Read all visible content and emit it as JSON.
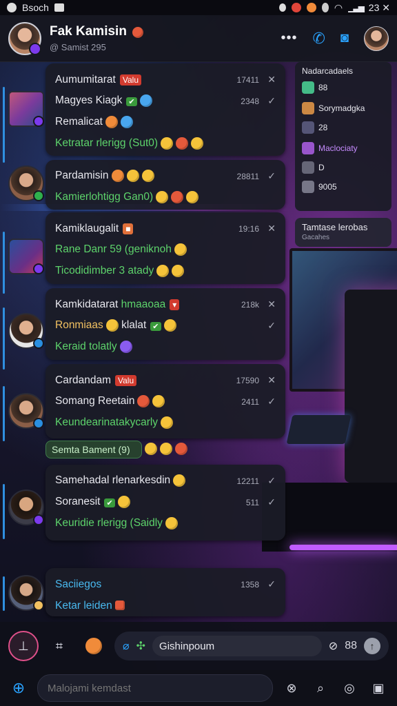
{
  "status": {
    "left_text": "Bsoch",
    "right_text": "23 ✕"
  },
  "header": {
    "title": "Fak Kamisin",
    "subtitle": "@ Samist 295"
  },
  "right_panel": {
    "title": "Nadarcadaels",
    "rows": [
      {
        "label": "88",
        "icon": "game-icon"
      },
      {
        "label": "Sorymadgka",
        "icon": "star-icon"
      },
      {
        "label": "28",
        "icon": "game-icon"
      },
      {
        "label": "Maclociaty",
        "icon": "crown-icon"
      },
      {
        "label": "D",
        "icon": "grid-icon"
      },
      {
        "label": "9005",
        "icon": "image-icon"
      }
    ],
    "popup_title": "Tamtase lerobas",
    "popup_sub": "Gacahes"
  },
  "messages": [
    {
      "lines": [
        {
          "text": "Aumumitarat",
          "tag": "Valu",
          "time": "17411",
          "tick": "✕"
        },
        {
          "text": "Magyes Kiagk",
          "time": "2348",
          "tick": "✓"
        },
        {
          "text": "Remalicat"
        },
        {
          "text": "Ketratar rlerigg (Sut0)",
          "style": "green"
        }
      ]
    },
    {
      "lines": [
        {
          "text": "Pardamisin",
          "time": "28811",
          "tick": "✓"
        },
        {
          "text": "Kamierlohtigg Gan0)",
          "style": "green"
        }
      ]
    },
    {
      "lines": [
        {
          "text": "Kamiklaugalit",
          "time": "19:16",
          "tick": "✕"
        },
        {
          "text": "Rane Danr 59 (geniknoh",
          "style": "green"
        },
        {
          "text": "Ticodidimber 3 atady",
          "style": "green"
        }
      ]
    },
    {
      "lines": [
        {
          "text": "Kamkidatarat",
          "text2": "hmaaoaa",
          "time": "218k",
          "tick": "✕"
        },
        {
          "text": "Ronmiaas",
          "text2": "klalat",
          "style": "gold",
          "tick": "✓"
        },
        {
          "text": "Keraid tolatly",
          "style": "green"
        }
      ]
    },
    {
      "lines": [
        {
          "text": "Cardandam",
          "tag": "Valu",
          "time": "17590",
          "tick": "✕"
        },
        {
          "text": "Somang Reetain",
          "time": "2411",
          "tick": "✓"
        },
        {
          "text": "Keundearinatakycarly",
          "style": "green"
        }
      ]
    },
    {
      "media_label": "Semta Bament (9)"
    },
    {
      "lines": [
        {
          "text": "Samehadal rlenarkesdin",
          "time": "12211",
          "tick": "✓"
        },
        {
          "text": "Soranesit",
          "time": "511",
          "tick": "✓"
        },
        {
          "text": "Keuridie rlerigg (Saidly",
          "style": "green"
        }
      ]
    },
    {
      "lines": [
        {
          "text": "Saciiegos",
          "style": "cyan",
          "time": "1358",
          "tick": "✓"
        },
        {
          "text": "Ketar leiden",
          "style": "cyan"
        }
      ]
    }
  ],
  "composer": {
    "value": "Gishinpoum",
    "count": "88"
  },
  "bottom_bar": {
    "placeholder": "Malojami kemdast"
  }
}
